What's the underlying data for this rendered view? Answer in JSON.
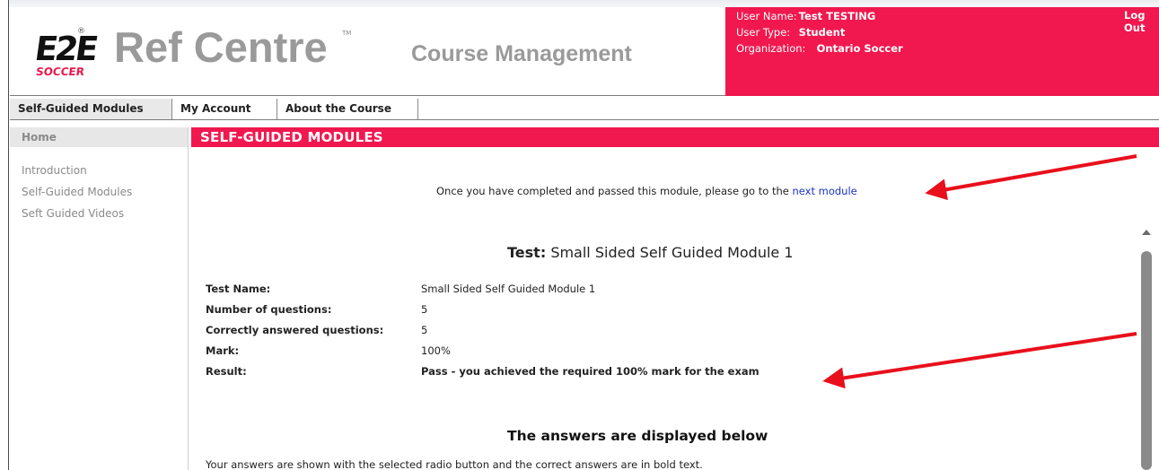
{
  "header": {
    "logo_text": "E2E",
    "logo_sub": "SOCCER",
    "brand": "Ref Centre",
    "subtitle": "Course Management",
    "user": {
      "name_label": "User Name:",
      "name_value": "Test TESTING",
      "type_label": "User Type:",
      "type_value": "Student",
      "org_label": "Organization:",
      "org_value": "Ontario Soccer",
      "logout": "Log Out"
    },
    "accent_color": "#f0184f"
  },
  "tabs": [
    {
      "label": "Self-Guided Modules",
      "active": true
    },
    {
      "label": "My Account",
      "active": false
    },
    {
      "label": "About the Course",
      "active": false
    }
  ],
  "sidebar": {
    "heading": "Home",
    "items": [
      "Introduction",
      "Self-Guided Modules",
      "Seft Guided Videos"
    ]
  },
  "main": {
    "section_title": "SELF-GUIDED MODULES",
    "notice_text": "Once you have completed and passed this module, please go to the",
    "notice_link": "next module",
    "test_title_label": "Test:",
    "test_title_name": "Small Sided Self Guided Module 1",
    "info": [
      {
        "label": "Test Name:",
        "value": "Small Sided Self Guided Module 1",
        "bold": false
      },
      {
        "label": "Number of questions:",
        "value": "5",
        "bold": false
      },
      {
        "label": "Correctly answered questions:",
        "value": "5",
        "bold": false
      },
      {
        "label": "Mark:",
        "value": "100%",
        "bold": false
      },
      {
        "label": "Result:",
        "value": "Pass - you achieved the required 100% mark for the exam",
        "bold": true
      }
    ],
    "answers_title": "The answers are displayed below",
    "answers_note": "Your answers are shown with the selected radio button and the correct answers are in bold text."
  },
  "annotation_color": "#e8101c"
}
